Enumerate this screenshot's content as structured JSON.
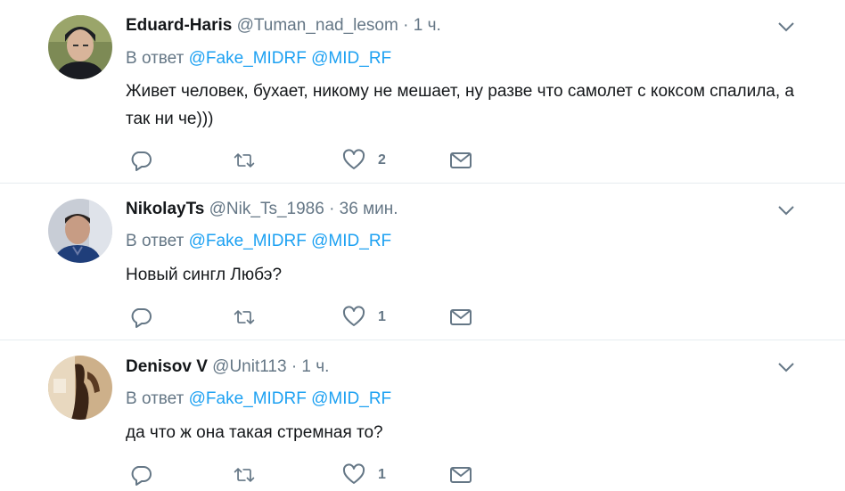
{
  "reply_prefix": "В ответ",
  "tweets": [
    {
      "name": "Eduard-Haris",
      "handle": "@Tuman_nad_lesom",
      "time": "1 ч.",
      "mentions": [
        "@Fake_MIDRF",
        "@MID_RF"
      ],
      "text": "Живет человек, бухает, никому не мешает, ну разве что самолет с коксом спалила, а так ни че)))",
      "likes": "2"
    },
    {
      "name": "NikolayTs",
      "handle": "@Nik_Ts_1986",
      "time": "36 мин.",
      "mentions": [
        "@Fake_MIDRF",
        "@MID_RF"
      ],
      "text": "Новый сингл Любэ?",
      "likes": "1"
    },
    {
      "name": "Denisov V",
      "handle": "@Unit113",
      "time": "1 ч.",
      "mentions": [
        "@Fake_MIDRF",
        "@MID_RF"
      ],
      "text": "да что ж она такая стремная то?",
      "likes": "1"
    }
  ],
  "colors": {
    "name": "#14171a",
    "meta": "#657786",
    "link": "#1da1f2",
    "divider": "#e6ecf0"
  },
  "icons": [
    "reply-icon",
    "retweet-icon",
    "like-icon",
    "dm-icon",
    "chevron-down-icon"
  ]
}
